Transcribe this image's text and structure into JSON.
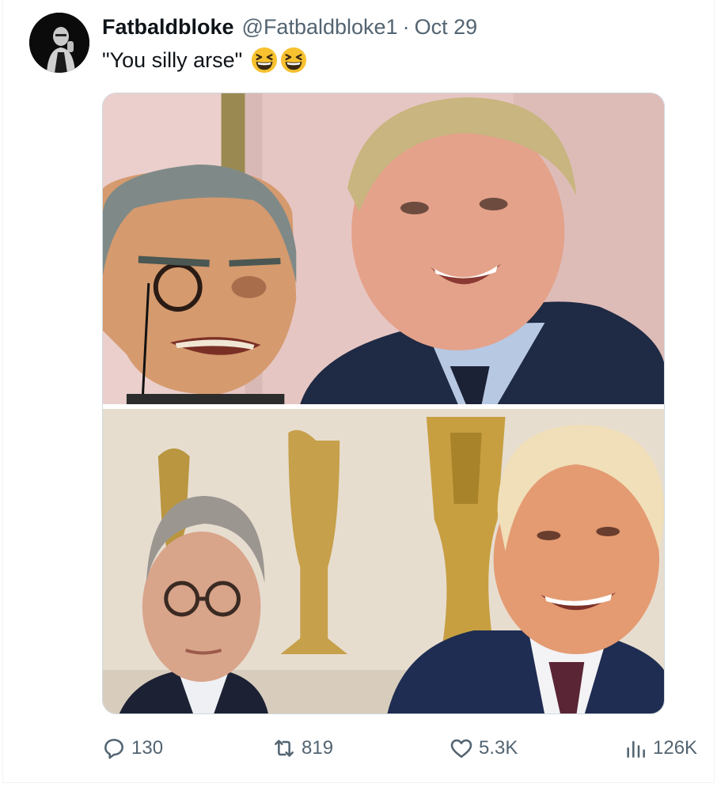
{
  "tweet": {
    "author_name": "Fatbaldbloke",
    "author_handle": "@Fatbaldbloke1",
    "separator": "·",
    "date": "Oct 29",
    "text": "\"You silly arse\"",
    "emojis": [
      "grinning-squinting-face",
      "grinning-squinting-face"
    ]
  },
  "actions": {
    "replies": "130",
    "reposts": "819",
    "likes": "5.3K",
    "views": "126K"
  },
  "colors": {
    "secondary_text": "#536471",
    "border": "#cfd9de",
    "emoji": "#f7c12f"
  }
}
